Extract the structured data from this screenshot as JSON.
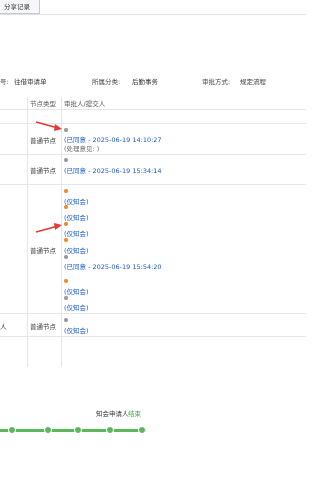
{
  "tab": {
    "label": "分享记录"
  },
  "info": {
    "left_label": "号:",
    "left_value": "往借审请单",
    "mid_label": "所属分类:",
    "mid_value": "后勤事务",
    "right_label": "审批方式:",
    "right_value": "规定流程"
  },
  "table": {
    "col_type": "节点类型",
    "col_approver": "审批人/提交人"
  },
  "rows": [
    {
      "type": "",
      "lines": [
        {
          "dot": "none",
          "text": "",
          "cls": ""
        }
      ]
    },
    {
      "type": "普通节点",
      "lines": [
        {
          "dot": "gray",
          "text": "",
          "cls": ""
        },
        {
          "dot": "none",
          "text": "(已同意 - 2025-06-19 14:10:27",
          "cls": "blue"
        },
        {
          "dot": "none",
          "text": "(处理意见: )",
          "cls": "gray"
        }
      ]
    },
    {
      "type": "普通节点",
      "lines": [
        {
          "dot": "gray",
          "text": "",
          "cls": ""
        },
        {
          "dot": "none",
          "text": "(已同意 - 2025-06-19 15:34:14",
          "cls": "blue"
        },
        {
          "dot": "none",
          "text": "",
          "cls": "blue"
        }
      ]
    },
    {
      "type": "普通节点",
      "left": "",
      "lines": [
        {
          "dot": "orange",
          "text": "",
          "cls": ""
        },
        {
          "dot": "none",
          "text": "(仅知会)",
          "cls": "blue"
        },
        {
          "dot": "orange",
          "text": "",
          "cls": ""
        },
        {
          "dot": "none",
          "text": "(仅知会)",
          "cls": "blue"
        },
        {
          "dot": "orange",
          "text": "",
          "cls": ""
        },
        {
          "dot": "none",
          "text": "(仅知会)",
          "cls": "blue"
        },
        {
          "dot": "orange",
          "text": "",
          "cls": ""
        },
        {
          "dot": "none",
          "text": "(仅知会)",
          "cls": "blue"
        },
        {
          "dot": "gray",
          "text": "",
          "cls": ""
        },
        {
          "dot": "none",
          "text": "(已同意 - 2025-06-19 15:54:20",
          "cls": "blue"
        },
        {
          "dot": "none",
          "text": "",
          "cls": "blue"
        },
        {
          "dot": "orange",
          "text": "",
          "cls": ""
        },
        {
          "dot": "none",
          "text": "(仅知会)",
          "cls": "blue"
        },
        {
          "dot": "gray",
          "text": "",
          "cls": ""
        },
        {
          "dot": "none",
          "text": "(仅知会)",
          "cls": "blue"
        }
      ]
    },
    {
      "type": "普通节点",
      "left": "人",
      "lines": [
        {
          "dot": "gray",
          "text": "",
          "cls": ""
        },
        {
          "dot": "none",
          "text": "(仅知会)",
          "cls": "blue"
        }
      ]
    }
  ],
  "flow": {
    "steps": [
      {
        "label": ""
      },
      {
        "label": ""
      },
      {
        "label": ""
      },
      {
        "label": "知会申请人"
      },
      {
        "label": "结束"
      }
    ]
  }
}
